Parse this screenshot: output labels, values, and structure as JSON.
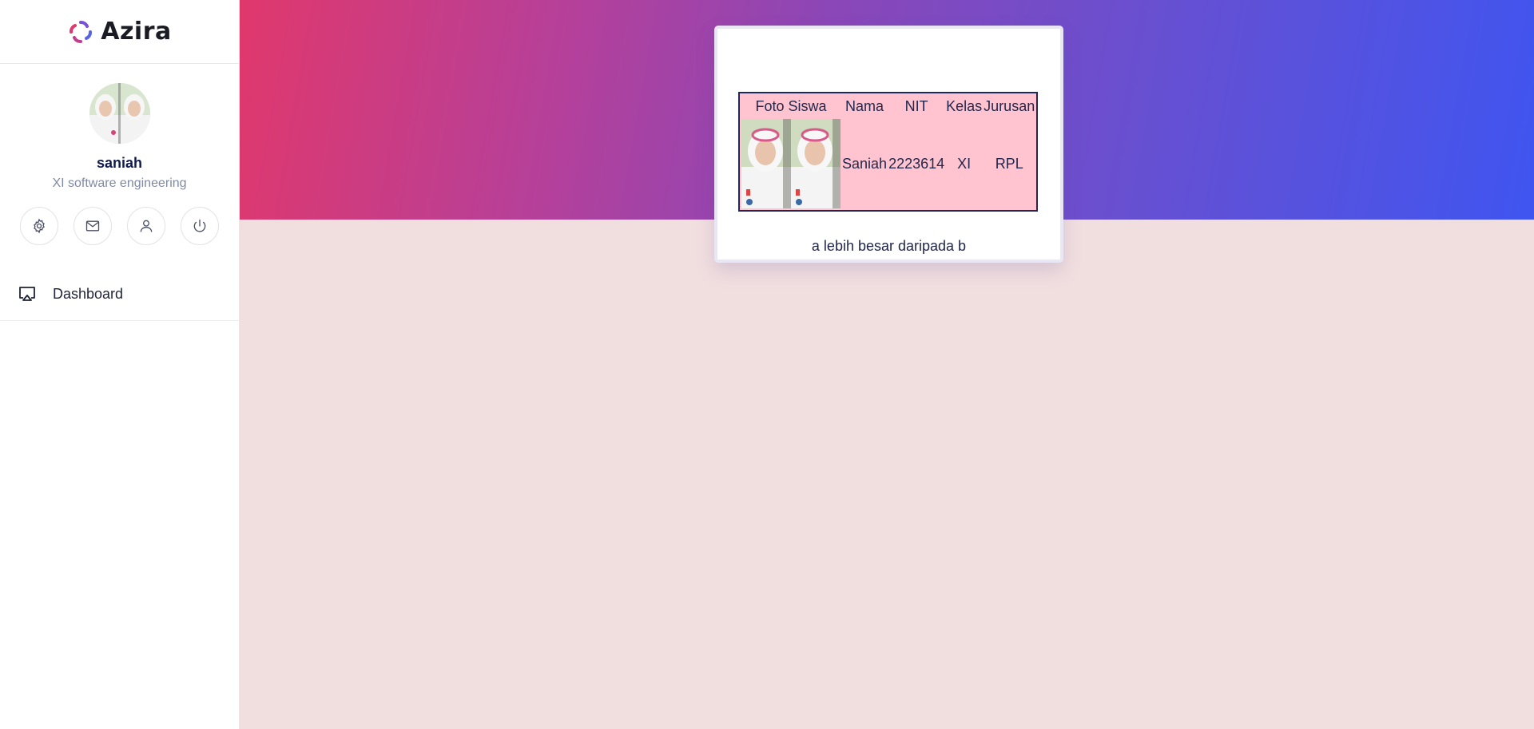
{
  "brand": {
    "name": "Azira"
  },
  "profile": {
    "name": "saniah",
    "role": "XI software engineering"
  },
  "actions": [
    "gear-icon",
    "mail-icon",
    "user-icon",
    "power-icon"
  ],
  "nav": {
    "items": [
      {
        "label": "Dashboard",
        "icon": "monitor-icon"
      }
    ]
  },
  "colors": {
    "hero_start": "#e0386c",
    "hero_end": "#3f55f0",
    "table_bg": "#ffc4cf",
    "page_bg": "#f1dfe0"
  },
  "table": {
    "headers": [
      "Foto Siswa",
      "Nama",
      "NIT",
      "Kelas",
      "Jurusan"
    ],
    "rows": [
      {
        "nama": "Saniah",
        "nit": "2223614",
        "kelas": "XI",
        "jurusan": "RPL"
      }
    ]
  },
  "card": {
    "caption": "a lebih besar daripada b"
  }
}
